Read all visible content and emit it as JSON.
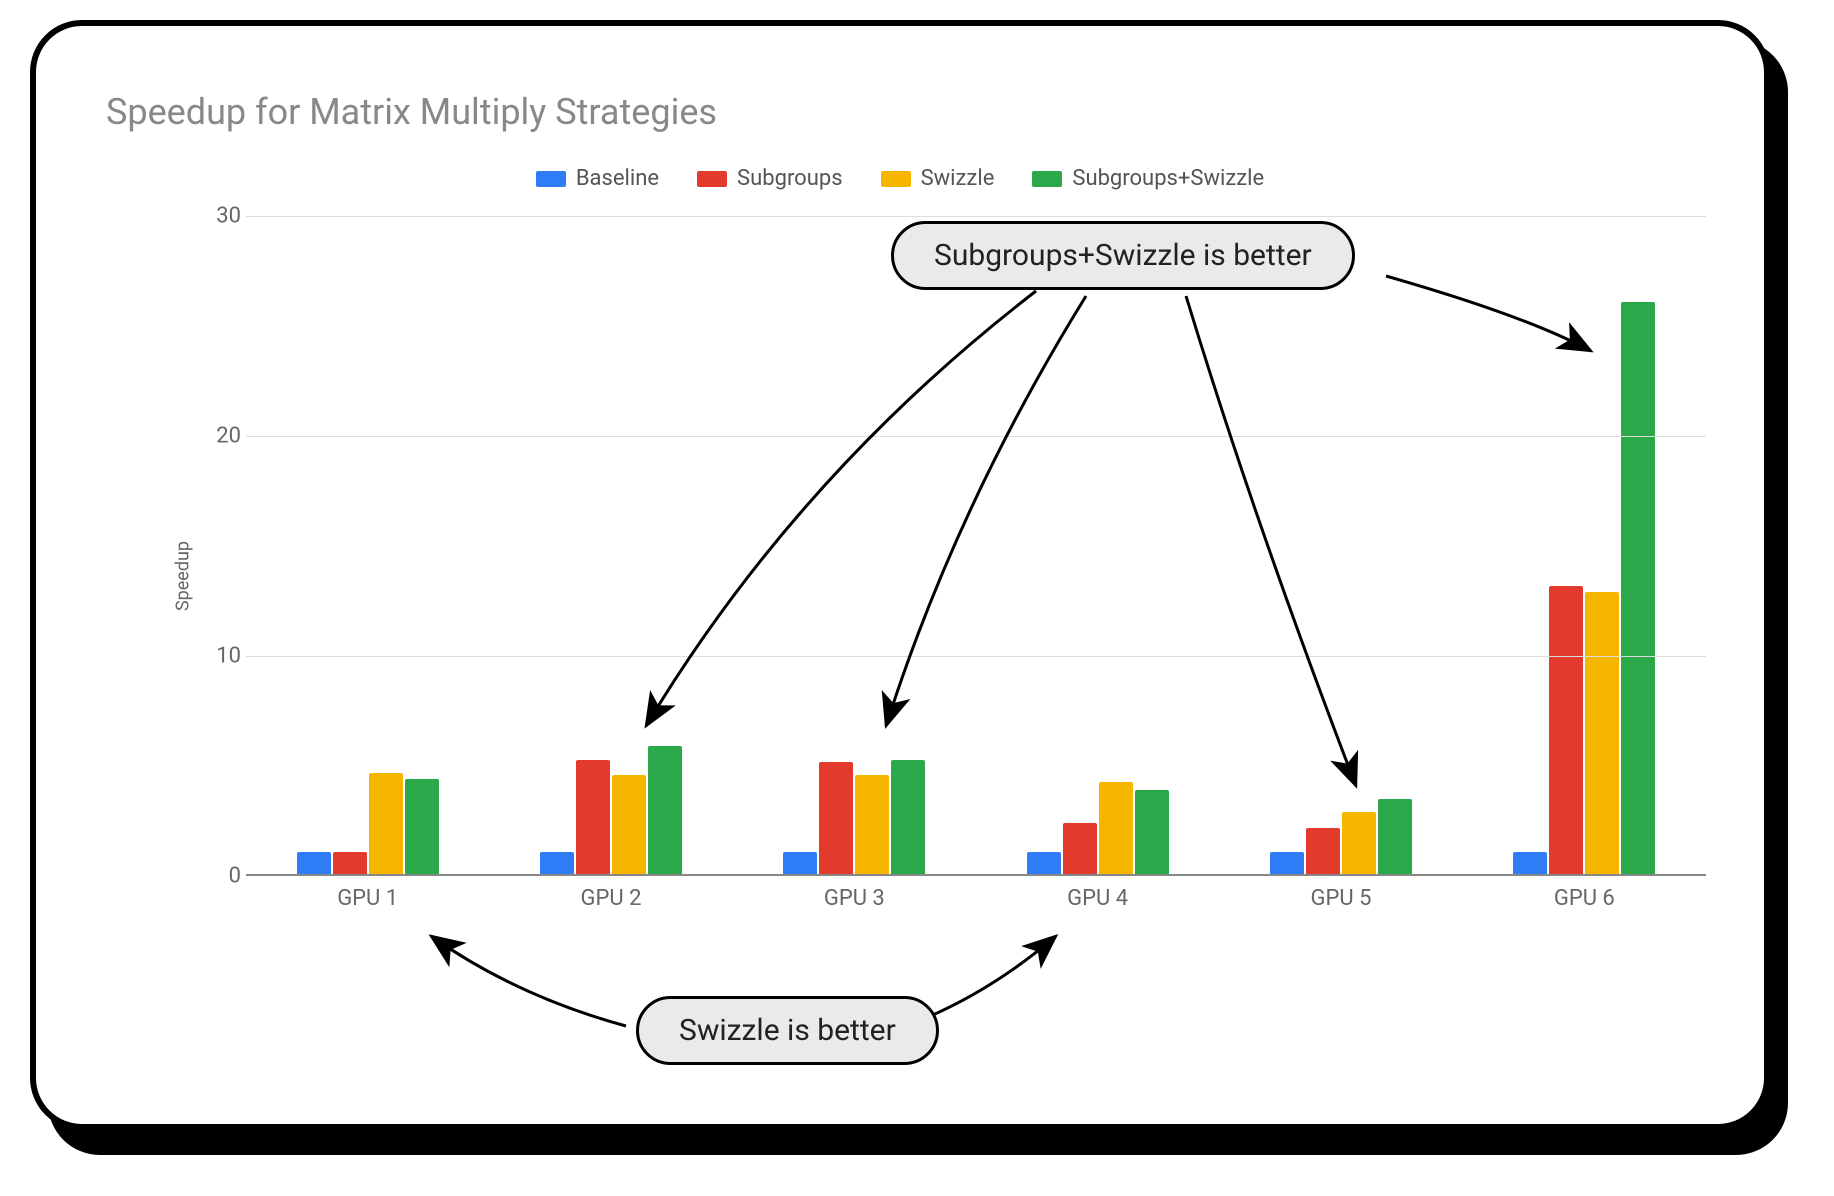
{
  "title": "Speedup for Matrix Multiply Strategies",
  "ylabel": "Speedup",
  "legend": [
    {
      "label": "Baseline",
      "color": "#2e7cf6"
    },
    {
      "label": "Subgroups",
      "color": "#e23b2e"
    },
    {
      "label": "Swizzle",
      "color": "#f6b600"
    },
    {
      "label": "Subgroups+Swizzle",
      "color": "#2ba84a"
    }
  ],
  "y_ticks": [
    0,
    10,
    20,
    30
  ],
  "categories": [
    "GPU 1",
    "GPU 2",
    "GPU 3",
    "GPU 4",
    "GPU 5",
    "GPU 6"
  ],
  "annotations": {
    "top": "Subgroups+Swizzle is better",
    "bottom": "Swizzle is better"
  },
  "chart_data": {
    "type": "bar",
    "title": "Speedup for Matrix Multiply Strategies",
    "xlabel": "",
    "ylabel": "Speedup",
    "ylim": [
      0,
      30
    ],
    "categories": [
      "GPU 1",
      "GPU 2",
      "GPU 3",
      "GPU 4",
      "GPU 5",
      "GPU 6"
    ],
    "series": [
      {
        "name": "Baseline",
        "color": "#2e7cf6",
        "values": [
          1.0,
          1.0,
          1.0,
          1.0,
          1.0,
          1.0
        ]
      },
      {
        "name": "Subgroups",
        "color": "#e23b2e",
        "values": [
          1.0,
          5.2,
          5.1,
          2.3,
          2.1,
          13.1
        ]
      },
      {
        "name": "Swizzle",
        "color": "#f6b600",
        "values": [
          4.6,
          4.5,
          4.5,
          4.2,
          2.8,
          12.8
        ]
      },
      {
        "name": "Subgroups+Swizzle",
        "color": "#2ba84a",
        "values": [
          4.3,
          5.8,
          5.2,
          3.8,
          3.4,
          26.0
        ]
      }
    ],
    "annotations": [
      {
        "text": "Subgroups+Swizzle is better",
        "targets": [
          "GPU 2",
          "GPU 3",
          "GPU 5",
          "GPU 6"
        ]
      },
      {
        "text": "Swizzle is better",
        "targets": [
          "GPU 1",
          "GPU 4"
        ]
      }
    ]
  }
}
